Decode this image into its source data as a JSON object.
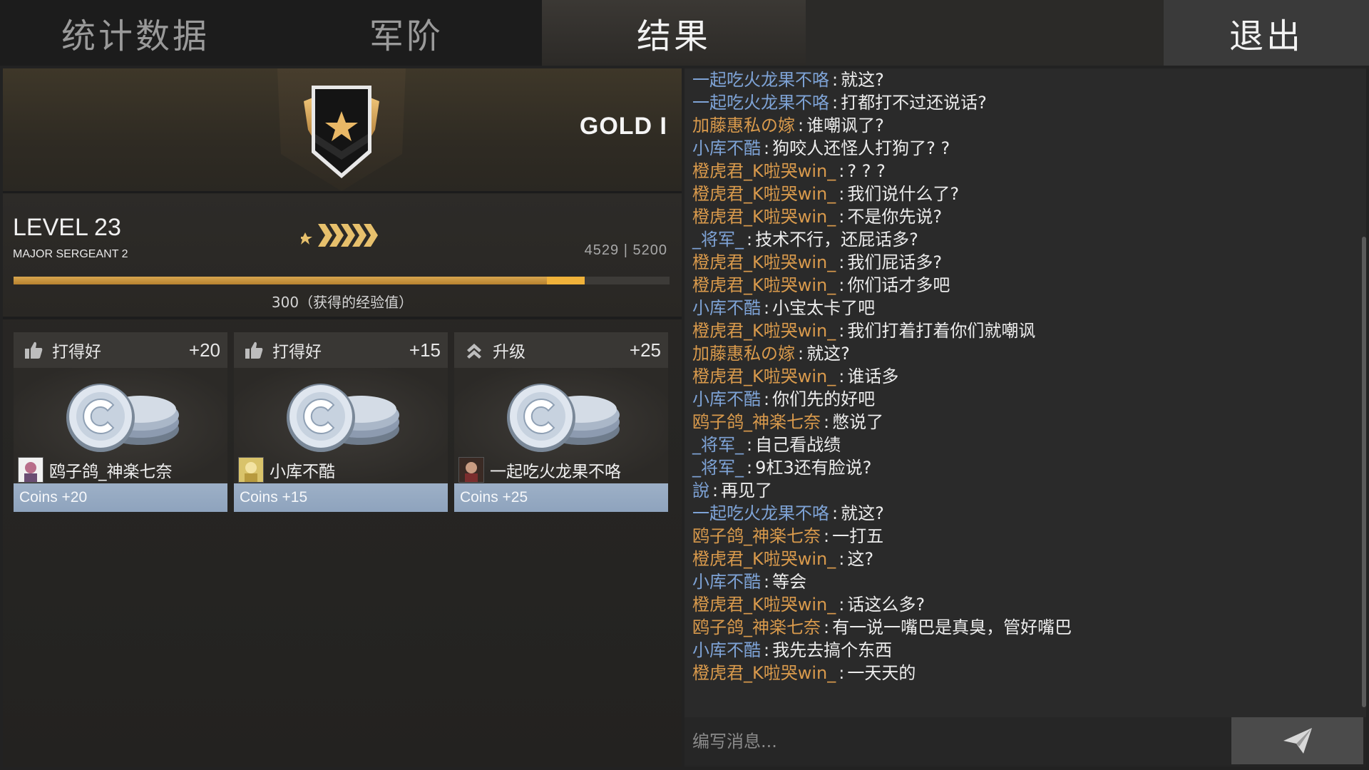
{
  "tabs": {
    "stats": "统计数据",
    "rank": "军阶",
    "results": "结果",
    "exit": "退出"
  },
  "rank": {
    "tier": "GOLD I",
    "level": "LEVEL 23",
    "rank_name": "MAJOR SERGEANT 2",
    "xp_current": "4529",
    "xp_sep": "|",
    "xp_max": "5200",
    "xp_gained_label": "300（获得的经验值）",
    "progress_before": 0.813,
    "progress_after": 0.871
  },
  "rewards": [
    {
      "label": "打得好",
      "points": "+20",
      "icon": "thumbs-up-icon",
      "player": "鸥子鸽_神楽七奈",
      "coins": "Coins +20"
    },
    {
      "label": "打得好",
      "points": "+15",
      "icon": "thumbs-up-icon",
      "player": "小库不酷",
      "coins": "Coins +15"
    },
    {
      "label": "升级",
      "points": "+25",
      "icon": "double-chevron-up-icon",
      "player": "一起吃火龙果不咯",
      "coins": "Coins +25"
    }
  ],
  "chat": {
    "placeholder": "编写消息...",
    "messages": [
      {
        "sender": "一起吃火龙果不咯",
        "color": "blue",
        "text": "就这?"
      },
      {
        "sender": "一起吃火龙果不咯",
        "color": "blue",
        "text": "打都打不过还说话?"
      },
      {
        "sender": "加藤惠私の嫁",
        "color": "orange",
        "text": "谁嘲讽了?"
      },
      {
        "sender": "小库不酷",
        "color": "blue",
        "text": "狗咬人还怪人打狗了? ?"
      },
      {
        "sender": "橙虎君_K啦哭win_",
        "color": "orange",
        "text": "? ? ?"
      },
      {
        "sender": "橙虎君_K啦哭win_",
        "color": "orange",
        "text": "我们说什么了?"
      },
      {
        "sender": "橙虎君_K啦哭win_",
        "color": "orange",
        "text": "不是你先说?"
      },
      {
        "sender": "_将军_",
        "color": "blue",
        "text": "技术不行，还屁话多?"
      },
      {
        "sender": "橙虎君_K啦哭win_",
        "color": "orange",
        "text": "我们屁话多?"
      },
      {
        "sender": "橙虎君_K啦哭win_",
        "color": "orange",
        "text": "你们话才多吧"
      },
      {
        "sender": "小库不酷",
        "color": "blue",
        "text": "小宝太卡了吧"
      },
      {
        "sender": "橙虎君_K啦哭win_",
        "color": "orange",
        "text": "我们打着打着你们就嘲讽"
      },
      {
        "sender": "加藤惠私の嫁",
        "color": "orange",
        "text": "就这?"
      },
      {
        "sender": "橙虎君_K啦哭win_",
        "color": "orange",
        "text": "谁话多"
      },
      {
        "sender": "小库不酷",
        "color": "blue",
        "text": "你们先的好吧"
      },
      {
        "sender": "鸥子鸽_神楽七奈",
        "color": "orange",
        "text": "憋说了"
      },
      {
        "sender": "_将军_",
        "color": "blue",
        "text": "自己看战绩"
      },
      {
        "sender": "_将军_",
        "color": "blue",
        "text": "9杠3还有脸说?"
      },
      {
        "sender": "說",
        "color": "blue",
        "text": "再见了"
      },
      {
        "sender": "一起吃火龙果不咯",
        "color": "blue",
        "text": "就这?"
      },
      {
        "sender": "鸥子鸽_神楽七奈",
        "color": "orange",
        "text": "一打五"
      },
      {
        "sender": "橙虎君_K啦哭win_",
        "color": "orange",
        "text": "这?"
      },
      {
        "sender": "小库不酷",
        "color": "blue",
        "text": "等会"
      },
      {
        "sender": "橙虎君_K啦哭win_",
        "color": "orange",
        "text": "话这么多?"
      },
      {
        "sender": "鸥子鸽_神楽七奈",
        "color": "orange",
        "text": "有一说一嘴巴是真臭，管好嘴巴"
      },
      {
        "sender": "小库不酷",
        "color": "blue",
        "text": "我先去搞个东西"
      },
      {
        "sender": "橙虎君_K啦哭win_",
        "color": "orange",
        "text": "一天天的"
      }
    ]
  },
  "colors": {
    "blue_name": "#7ea3d6",
    "orange_name": "#d99a4c",
    "xp_bar": "#d7a54e",
    "coins_bar": "#8ea3bd"
  }
}
